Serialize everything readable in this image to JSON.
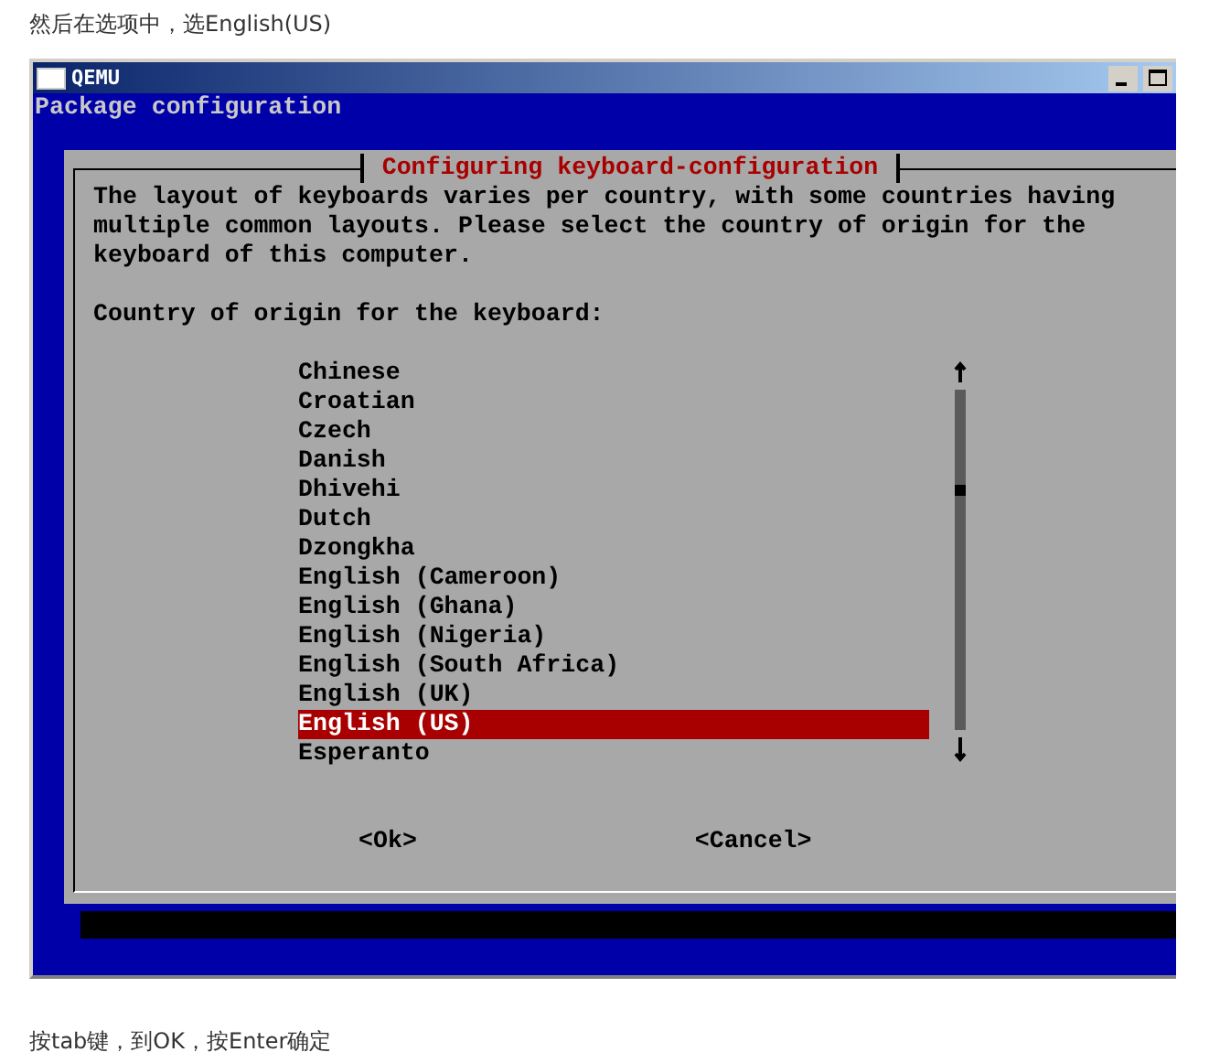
{
  "caption_top": "然后在选项中，选English(US)",
  "window": {
    "title": "QEMU"
  },
  "screen_header": "Package configuration",
  "dialog": {
    "title": "Configuring keyboard-configuration",
    "description": "The layout of keyboards varies per country, with some countries having multiple common layouts. Please select the country of origin for the keyboard of this computer.",
    "prompt": "Country of origin for the keyboard:",
    "items": [
      {
        "label": "Chinese",
        "selected": false
      },
      {
        "label": "Croatian",
        "selected": false
      },
      {
        "label": "Czech",
        "selected": false
      },
      {
        "label": "Danish",
        "selected": false
      },
      {
        "label": "Dhivehi",
        "selected": false
      },
      {
        "label": "Dutch",
        "selected": false
      },
      {
        "label": "Dzongkha",
        "selected": false
      },
      {
        "label": "English (Cameroon)",
        "selected": false
      },
      {
        "label": "English (Ghana)",
        "selected": false
      },
      {
        "label": "English (Nigeria)",
        "selected": false
      },
      {
        "label": "English (South Africa)",
        "selected": false
      },
      {
        "label": "English (UK)",
        "selected": false
      },
      {
        "label": "English (US)",
        "selected": true
      },
      {
        "label": "Esperanto",
        "selected": false
      }
    ],
    "buttons": [
      "<Ok>",
      "<Cancel>"
    ]
  },
  "caption_bottom": "按tab键，到OK，按Enter确定"
}
